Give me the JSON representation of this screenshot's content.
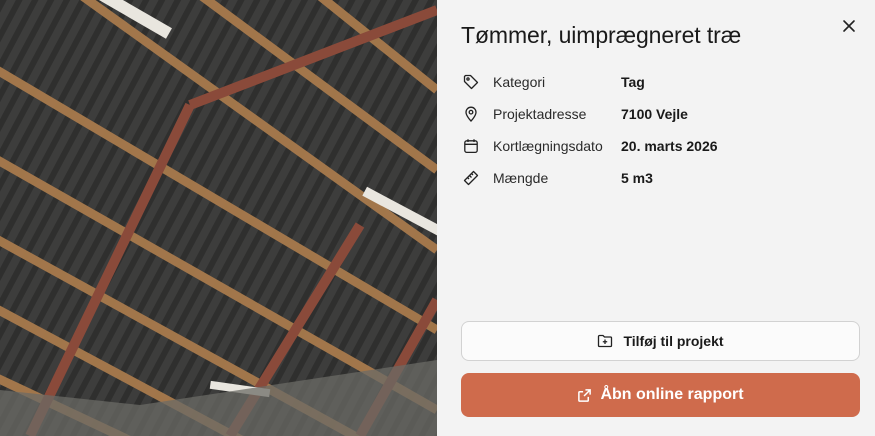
{
  "photo": {
    "description_icon": "roof-photo"
  },
  "panel": {
    "title": "Tømmer, uimprægneret træ",
    "close_icon": "close-icon",
    "details": [
      {
        "icon": "tag-icon",
        "label": "Kategori",
        "value": "Tag"
      },
      {
        "icon": "location-pin-icon",
        "label": "Projektadresse",
        "value": "7100 Vejle"
      },
      {
        "icon": "calendar-icon",
        "label": "Kortlægningsdato",
        "value": "20. marts 2026"
      },
      {
        "icon": "ruler-icon",
        "label": "Mængde",
        "value": "5 m3"
      }
    ],
    "add_to_project_label": "Tilføj til projekt",
    "open_report_label": "Åbn online rapport"
  },
  "colors": {
    "accent": "#cf6b4c",
    "background": "#f3f3f3"
  }
}
